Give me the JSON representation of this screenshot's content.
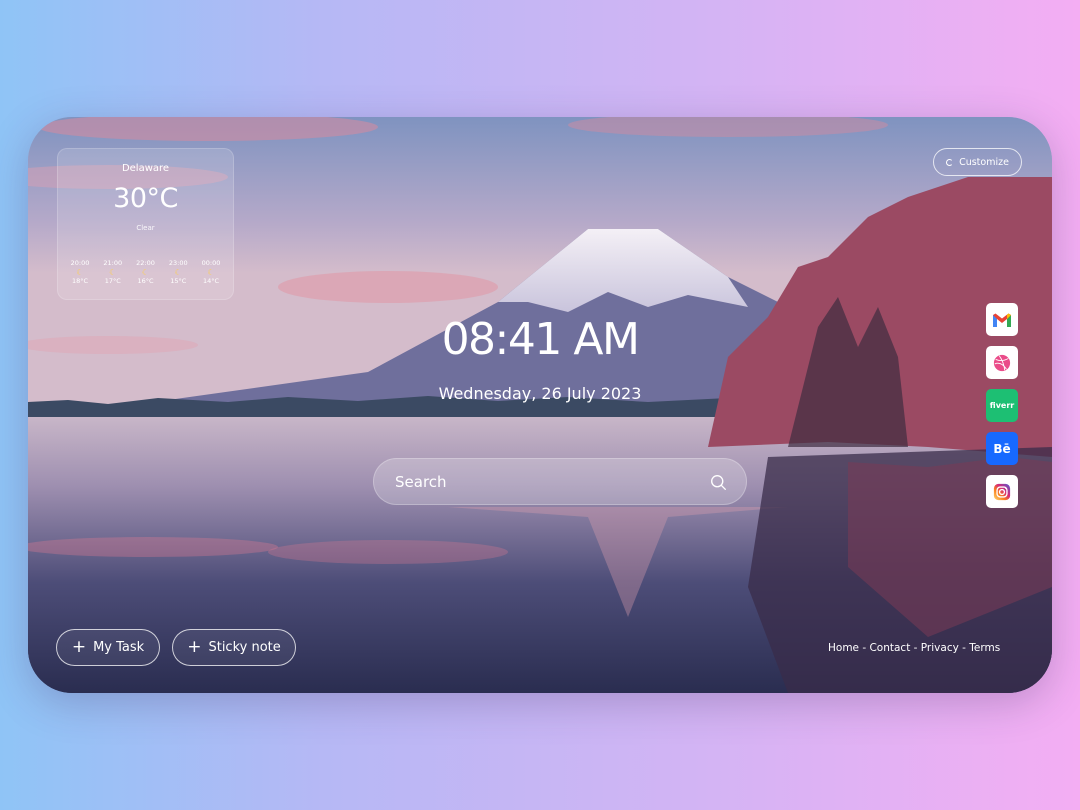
{
  "weather": {
    "location": "Delaware",
    "temperature": "30°C",
    "condition": "Clear",
    "hourly": [
      {
        "time": "20:00",
        "icon": "moon-icon",
        "temp": "18°C"
      },
      {
        "time": "21:00",
        "icon": "moon-icon",
        "temp": "17°C"
      },
      {
        "time": "22:00",
        "icon": "moon-icon",
        "temp": "16°C"
      },
      {
        "time": "23:00",
        "icon": "moon-icon",
        "temp": "15°C"
      },
      {
        "time": "00:00",
        "icon": "moon-icon",
        "temp": "14°C"
      }
    ]
  },
  "customize": {
    "label": "Customize",
    "icon": "loading-icon"
  },
  "clock": {
    "time": "08:41 AM",
    "date": "Wednesday, 26 July 2023"
  },
  "search": {
    "placeholder": "Search",
    "icon": "search-icon"
  },
  "apps": [
    {
      "name": "Gmail",
      "icon": "gmail-icon"
    },
    {
      "name": "Dribbble",
      "icon": "dribbble-icon"
    },
    {
      "name": "fiverr",
      "label": "fiverr",
      "icon": "fiverr-icon"
    },
    {
      "name": "Behance",
      "label": "Bē",
      "icon": "behance-icon"
    },
    {
      "name": "Instagram",
      "icon": "instagram-icon"
    }
  ],
  "actions": {
    "my_task": "My Task",
    "sticky_note": "Sticky note",
    "plus_glyph": "+"
  },
  "footer": {
    "links": "Home - Contact - Privacy - Terms"
  },
  "colors": {
    "background_left": "#8fc4f6",
    "background_right": "#f4aef3",
    "fiverr": "#1dbf73",
    "behance": "#1769ff",
    "moon": "#ffd04a"
  }
}
